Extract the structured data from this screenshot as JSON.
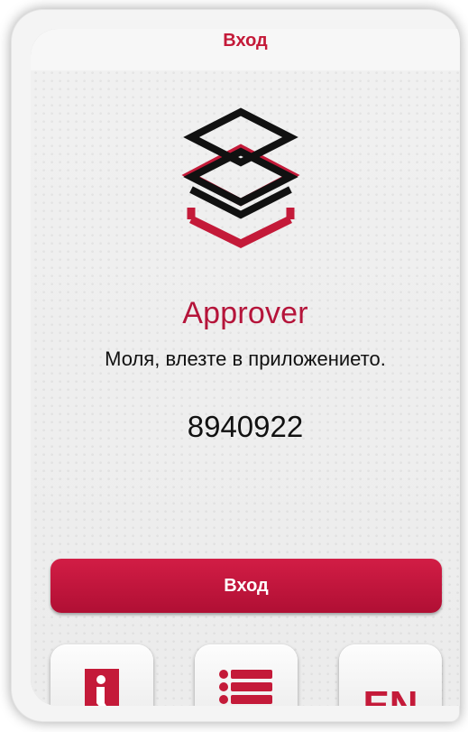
{
  "header": {
    "title": "Вход"
  },
  "main": {
    "app_name": "Approver",
    "subtitle": "Моля, влезте в приложението.",
    "code": "8940922",
    "login_label": "Вход"
  },
  "bottom_buttons": [
    {
      "icon": "info-icon"
    },
    {
      "icon": "list-icon"
    },
    {
      "label": "EN"
    }
  ],
  "colors": {
    "accent": "#c41a39",
    "logo_black": "#111111",
    "background": "#eeeeee"
  }
}
